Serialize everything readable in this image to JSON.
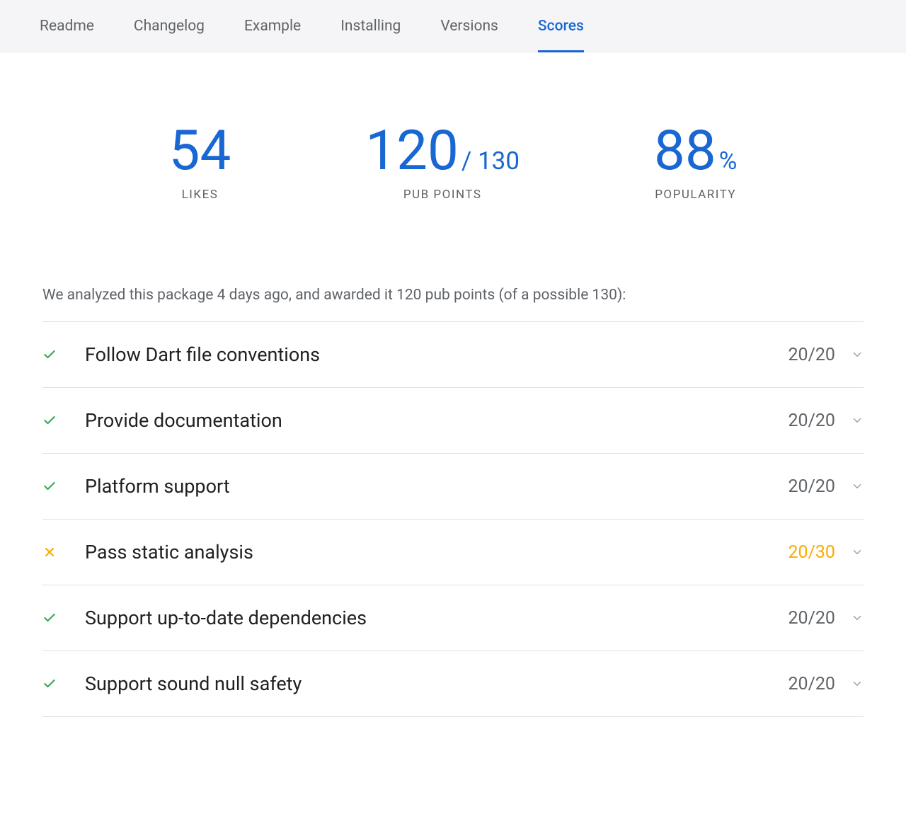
{
  "tabs": [
    {
      "label": "Readme",
      "active": false
    },
    {
      "label": "Changelog",
      "active": false
    },
    {
      "label": "Example",
      "active": false
    },
    {
      "label": "Installing",
      "active": false
    },
    {
      "label": "Versions",
      "active": false
    },
    {
      "label": "Scores",
      "active": true
    }
  ],
  "scores": {
    "likes": {
      "value": "54",
      "label": "LIKES"
    },
    "pubpoints": {
      "value": "120",
      "max": "/ 130",
      "label": "PUB POINTS"
    },
    "popularity": {
      "value": "88",
      "suffix": "%",
      "label": "POPULARITY"
    }
  },
  "analysis_text": "We analyzed this package 4 days ago, and awarded it 120 pub points (of a possible 130):",
  "criteria": [
    {
      "title": "Follow Dart file conventions",
      "score": "20/20",
      "status": "pass"
    },
    {
      "title": "Provide documentation",
      "score": "20/20",
      "status": "pass"
    },
    {
      "title": "Platform support",
      "score": "20/20",
      "status": "pass"
    },
    {
      "title": "Pass static analysis",
      "score": "20/30",
      "status": "warn"
    },
    {
      "title": "Support up-to-date dependencies",
      "score": "20/20",
      "status": "pass"
    },
    {
      "title": "Support sound null safety",
      "score": "20/20",
      "status": "pass"
    }
  ]
}
